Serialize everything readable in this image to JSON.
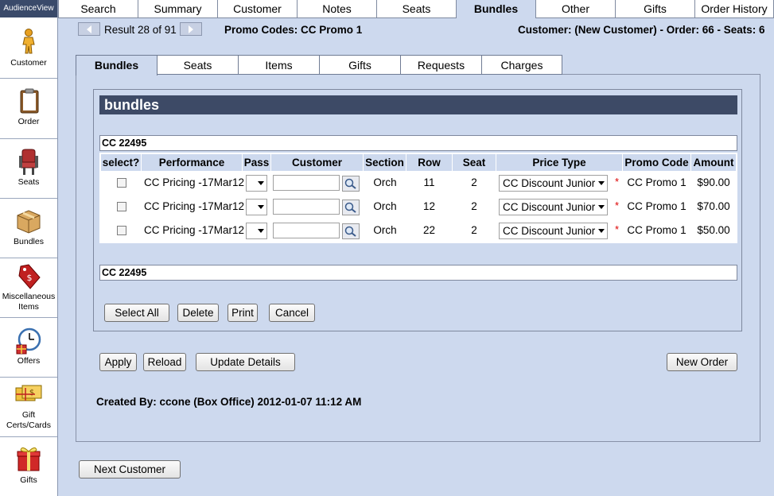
{
  "brand": "AudienceView",
  "sidebar": [
    {
      "label": "Customer",
      "icon": "person-icon"
    },
    {
      "label": "Order",
      "icon": "clipboard-icon"
    },
    {
      "label": "Seats",
      "icon": "seat-icon"
    },
    {
      "label": "Bundles",
      "icon": "box-icon"
    },
    {
      "label": "Miscellaneous Items",
      "icon": "price-tag-icon"
    },
    {
      "label": "Offers",
      "icon": "clock-icon"
    },
    {
      "label": "Gift Certs/Cards",
      "icon": "gift-card-icon"
    },
    {
      "label": "Gifts",
      "icon": "gift-icon"
    }
  ],
  "top_tabs": [
    "Search",
    "Summary",
    "Customer",
    "Notes",
    "Seats",
    "Bundles",
    "Other",
    "Gifts",
    "Order History"
  ],
  "nav": {
    "result": "Result 28 of 91",
    "promo": "Promo Codes: CC Promo 1",
    "customer_info": "Customer: (New Customer) - Order: 66 - Seats: 6"
  },
  "sub_tabs": [
    "Bundles",
    "Seats",
    "Items",
    "Gifts",
    "Requests",
    "Charges"
  ],
  "section_title": "bundles",
  "group_label_top": "CC 22495",
  "group_label_bottom": "CC 22495",
  "columns": [
    "select?",
    "Performance",
    "Pass",
    "Customer",
    "Section",
    "Row",
    "Seat",
    "Price Type",
    "Promo Code",
    "Amount"
  ],
  "rows": [
    {
      "performance": "CC Pricing -17Mar12",
      "section": "Orch",
      "row": "11",
      "seat": "2",
      "price_type": "CC Discount Junior",
      "promo": "CC Promo 1",
      "amount": "$90.00"
    },
    {
      "performance": "CC Pricing -17Mar12",
      "section": "Orch",
      "row": "12",
      "seat": "2",
      "price_type": "CC Discount Junior",
      "promo": "CC Promo 1",
      "amount": "$70.00"
    },
    {
      "performance": "CC Pricing -17Mar12",
      "section": "Orch",
      "row": "22",
      "seat": "2",
      "price_type": "CC Discount Junior",
      "promo": "CC Promo 1",
      "amount": "$50.00"
    }
  ],
  "required_mark": "*",
  "inner_buttons": [
    "Select All",
    "Delete",
    "Print",
    "Cancel"
  ],
  "action_buttons": [
    "Apply",
    "Reload",
    "Update Details"
  ],
  "new_order": "New Order",
  "created_by": "Created By: ccone (Box Office) 2012-01-07 11:12 AM",
  "next_customer": "Next Customer"
}
